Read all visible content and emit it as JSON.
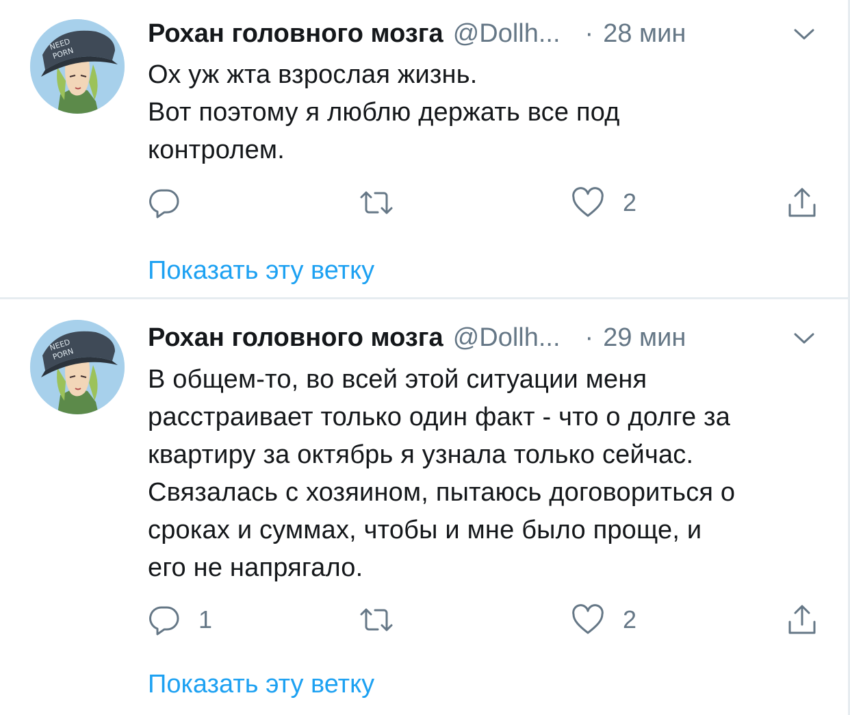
{
  "tweets": [
    {
      "author_name": "Рохан головного мозга",
      "handle": "@Dollh...",
      "dot": "·",
      "time": "28 мин",
      "avatar_text": [
        "NEED",
        "PORN"
      ],
      "text_lines": [
        "Ох уж жта взрослая жизнь.",
        "Вот поэтому я люблю держать все под",
        "контролем."
      ],
      "reply_count": "",
      "retweet_count": "",
      "like_count": "2",
      "show_thread": "Показать эту ветку"
    },
    {
      "author_name": "Рохан головного мозга",
      "handle": "@Dollh...",
      "dot": "·",
      "time": "29 мин",
      "avatar_text": [
        "NEED",
        "PORN"
      ],
      "text_lines": [
        "В общем-то, во всей этой ситуации меня",
        "расстраивает только один факт - что о долге за",
        "квартиру за октябрь я узнала только сейчас.",
        "Связалась с хозяином, пытаюсь договориться о",
        "сроках и суммах, чтобы и мне было проще, и",
        "его не напрягало."
      ],
      "reply_count": "1",
      "retweet_count": "",
      "like_count": "2",
      "show_thread": "Показать эту ветку"
    }
  ],
  "icons": {
    "reply": "reply-icon",
    "retweet": "retweet-icon",
    "like": "heart-icon",
    "share": "share-icon",
    "menu": "chevron-down-icon"
  },
  "colors": {
    "link": "#1da1f2",
    "secondary": "#657786",
    "text": "#14171a",
    "divider": "#e6ecf0"
  }
}
